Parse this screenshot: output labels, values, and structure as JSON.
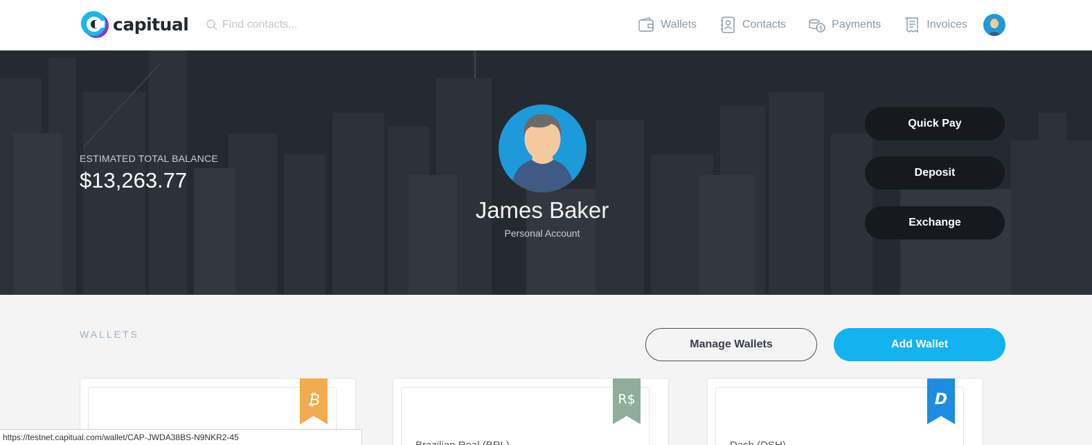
{
  "app": {
    "logo_text": "capitual"
  },
  "search": {
    "placeholder": "Find contacts..."
  },
  "nav": {
    "items": [
      {
        "label": "Wallets",
        "icon": "wallet-icon"
      },
      {
        "label": "Contacts",
        "icon": "contacts-icon"
      },
      {
        "label": "Payments",
        "icon": "payments-icon"
      },
      {
        "label": "Invoices",
        "icon": "invoices-icon"
      }
    ]
  },
  "balance": {
    "label": "ESTIMATED TOTAL BALANCE",
    "value": "$13,263.77"
  },
  "profile": {
    "name": "James Baker",
    "account_type": "Personal Account"
  },
  "actions": {
    "quick_pay": "Quick Pay",
    "deposit": "Deposit",
    "exchange": "Exchange"
  },
  "wallets": {
    "title": "WALLETS",
    "manage_label": "Manage Wallets",
    "add_label": "Add Wallet",
    "cards": [
      {
        "name": "",
        "currency_symbol": "₿",
        "ribbon_color": "#f0ad4e"
      },
      {
        "name": "Brazilian Real (BRL)",
        "currency_symbol": "R$",
        "ribbon_color": "#8fae9a"
      },
      {
        "name": "Dash (DSH)",
        "currency_symbol": "D",
        "ribbon_color": "#1c8de0"
      }
    ]
  },
  "status_bar": {
    "url": "https://testnet.capitual.com/wallet/CAP-JWDA38BS-N9NKR2-45"
  },
  "colors": {
    "accent": "#12b3ef",
    "hero_bg": "#2b3138",
    "dark_button": "#161a1e"
  }
}
